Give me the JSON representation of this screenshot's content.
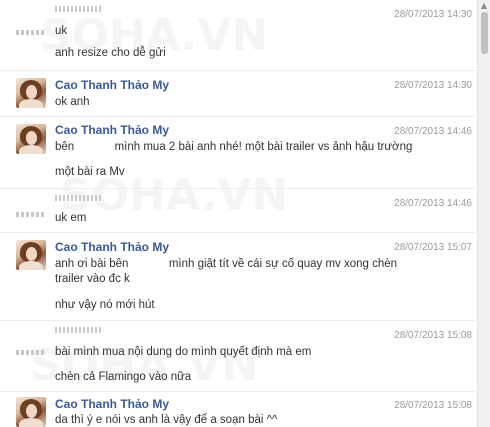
{
  "watermark": "SOHA.VN",
  "contact_name": "Cao Thanh Thảo My",
  "messages": [
    {
      "time": "28/07/2013 14:30",
      "lines": [
        "uk",
        "anh resize cho dễ gửi"
      ]
    },
    {
      "time": "28/07/2013 14:30",
      "lines": [
        "ok anh"
      ]
    },
    {
      "time": "28/07/2013 14:46",
      "line1_a": "bên",
      "line1_b": "mình mua 2 bài anh nhé! một bài trailer vs ảnh hậu trường",
      "line2": "một bài ra Mv"
    },
    {
      "time": "28/07/2013 14:46",
      "lines": [
        "uk em"
      ]
    },
    {
      "time": "28/07/2013 15:07",
      "line1_a": "anh ơi bài bên",
      "line1_b": "mình giật tít về cái sự cố quay mv xong chèn",
      "line2": "trailer vào đc k",
      "line3": "như vậy nó mới hút"
    },
    {
      "time": "28/07/2013 15:08",
      "lines": [
        "bài mình mua nội dung do mình quyết định mà em",
        "chèn cả Flamingo vào nữa"
      ]
    },
    {
      "time": "28/07/2013 15:08",
      "lines": [
        "da thì ý e nói vs anh là vậy để a soạn bài ^^"
      ]
    }
  ],
  "colors": {
    "name": "#3b5998",
    "time": "#9a9a9a",
    "text": "#333333"
  }
}
